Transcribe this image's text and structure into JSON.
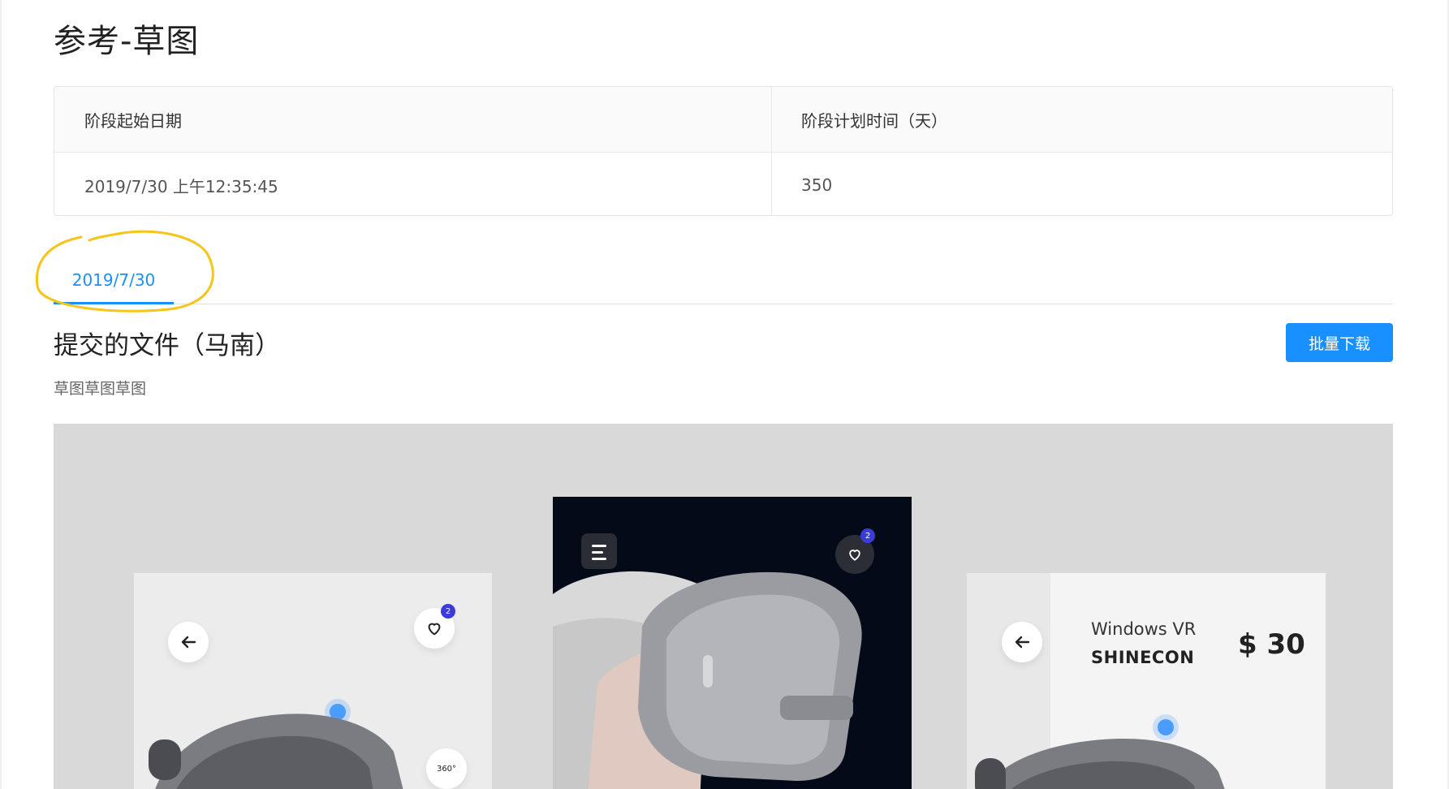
{
  "page": {
    "title": "参考-草图"
  },
  "info_table": {
    "headers": [
      "阶段起始日期",
      "阶段计划时间（天）"
    ],
    "row": [
      "2019/7/30 上午12:35:45",
      "350"
    ]
  },
  "tabs": [
    {
      "label": "2019/7/30",
      "active": true
    }
  ],
  "submission": {
    "title": "提交的文件（马南）",
    "batch_download_label": "批量下载",
    "description": "草图草图草图"
  },
  "preview": {
    "left_card": {
      "badge": "2",
      "rotate_label": "360°"
    },
    "center_card": {
      "badge": "2"
    },
    "right_card": {
      "title": "Windows VR",
      "brand": "SHINECON",
      "price": "$ 30"
    }
  },
  "colors": {
    "accent": "#1890ff",
    "annotation": "#f5c518"
  },
  "icons": [
    "back-arrow-icon",
    "heart-icon",
    "menu-icon",
    "rotate-360-icon"
  ]
}
